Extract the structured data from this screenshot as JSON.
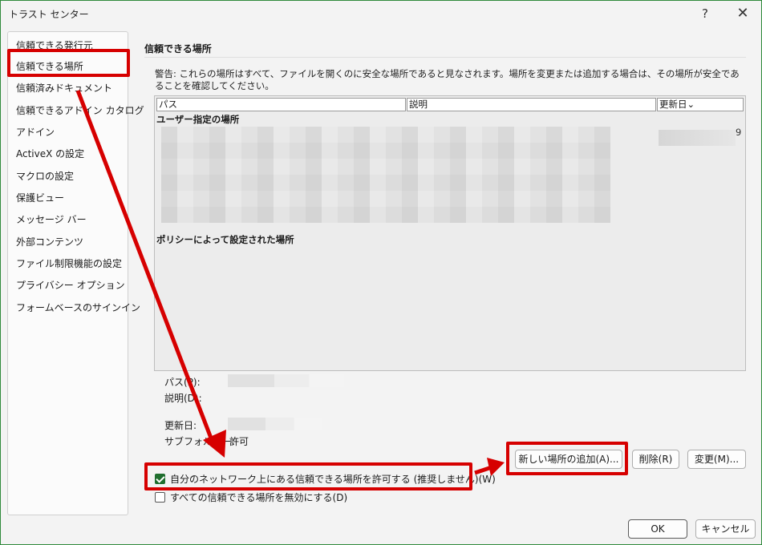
{
  "window": {
    "title": "トラスト センター",
    "help": "?",
    "close": "✕"
  },
  "sidebar": {
    "items": [
      {
        "label": "信頼できる発行元"
      },
      {
        "label": "信頼できる場所"
      },
      {
        "label": "信頼済みドキュメント"
      },
      {
        "label": "信頼できるアドイン カタログ"
      },
      {
        "label": "アドイン"
      },
      {
        "label": "ActiveX の設定"
      },
      {
        "label": "マクロの設定"
      },
      {
        "label": "保護ビュー"
      },
      {
        "label": "メッセージ バー"
      },
      {
        "label": "外部コンテンツ"
      },
      {
        "label": "ファイル制限機能の設定"
      },
      {
        "label": "プライバシー オプション"
      },
      {
        "label": "フォームベースのサインイン"
      }
    ]
  },
  "main": {
    "title": "信頼できる場所",
    "warning": "警告: これらの場所はすべて、ファイルを開くのに安全な場所であると見なされます。場所を変更または追加する場合は、その場所が安全であることを確認してください。",
    "table": {
      "columns": [
        "パス",
        "説明",
        "更新日⌄"
      ],
      "user_section": "ユーザー指定の場所",
      "policy_section": "ポリシーによって設定された場所",
      "cut_digit": "9"
    },
    "details": {
      "path_label": "パス(P):",
      "desc_label": "説明(D):",
      "date_label": "更新日:",
      "subfolder_label": "サブフォルダー:",
      "subfolder_value": "許可"
    },
    "buttons": {
      "add": "新しい場所の追加(A)...",
      "delete": "削除(R)",
      "modify": "変更(M)..."
    },
    "checks": {
      "network": {
        "label": "自分のネットワーク上にある信頼できる場所を許可する (推奨しません)(W)",
        "checked": true
      },
      "disable_all": {
        "label": "すべての信頼できる場所を無効にする(D)",
        "checked": false
      }
    }
  },
  "footer": {
    "ok": "OK",
    "cancel": "キャンセル"
  },
  "colors": {
    "annotation_red": "#d60000",
    "check_green": "#1f6e2e",
    "window_border": "#2f8a3b"
  }
}
